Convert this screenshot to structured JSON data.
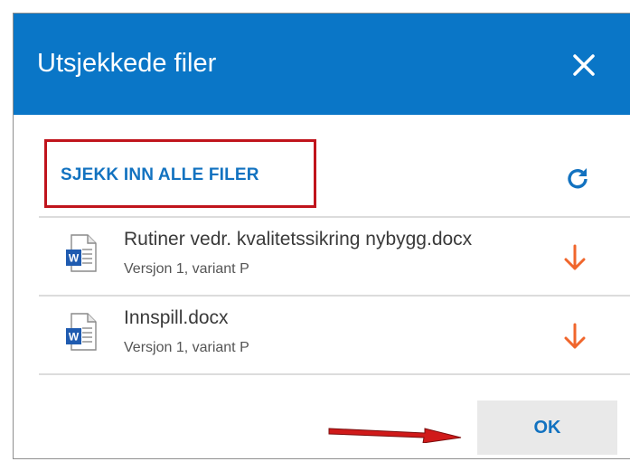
{
  "dialog": {
    "title": "Utsjekkede filer",
    "close_icon": "close-icon",
    "checkin_all_label": "SJEKK INN ALLE FILER",
    "refresh_icon": "refresh-icon",
    "files": [
      {
        "name": "Rutiner vedr. kvalitetssikring nybygg.docx",
        "meta": "Versjon 1, variant P",
        "icon": "word-document-icon",
        "action_icon": "download-arrow-icon"
      },
      {
        "name": "Innspill.docx",
        "meta": "Versjon 1, variant P",
        "icon": "word-document-icon",
        "action_icon": "download-arrow-icon"
      }
    ],
    "ok_label": "OK"
  },
  "colors": {
    "header": "#0a76c7",
    "link": "#1272c0",
    "highlight_border": "#c0141c",
    "download_arrow": "#f0662c",
    "annotation_arrow": "#d01a1a"
  }
}
